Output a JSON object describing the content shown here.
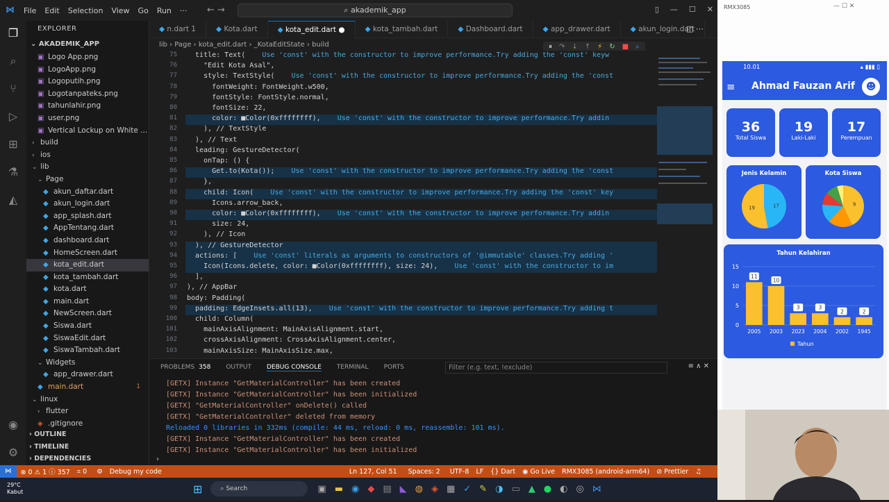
{
  "menu": [
    "File",
    "Edit",
    "Selection",
    "View",
    "Go",
    "Run",
    "···"
  ],
  "search_label": "akademik_app",
  "explorer_title": "EXPLORER",
  "project": "AKADEMIK_APP",
  "tree": [
    {
      "label": "Logo App.png",
      "type": "img",
      "indent": 2
    },
    {
      "label": "LogoApp.png",
      "type": "img",
      "indent": 2
    },
    {
      "label": "Logoputih.png",
      "type": "img",
      "indent": 2
    },
    {
      "label": "Logotanpateks.png",
      "type": "img",
      "indent": 2
    },
    {
      "label": "tahunlahir.png",
      "type": "img",
      "indent": 2
    },
    {
      "label": "user.png",
      "type": "img",
      "indent": 2
    },
    {
      "label": "Vertical Lockup on White ...",
      "type": "img",
      "indent": 2
    },
    {
      "label": "build",
      "type": "folder",
      "indent": 1,
      "open": false
    },
    {
      "label": "ios",
      "type": "folder",
      "indent": 1,
      "open": false
    },
    {
      "label": "lib",
      "type": "folder",
      "indent": 1,
      "open": true
    },
    {
      "label": "Page",
      "type": "folder",
      "indent": 2,
      "open": true
    },
    {
      "label": "akun_daftar.dart",
      "type": "dart",
      "indent": 3
    },
    {
      "label": "akun_login.dart",
      "type": "dart",
      "indent": 3
    },
    {
      "label": "app_splash.dart",
      "type": "dart",
      "indent": 3
    },
    {
      "label": "AppTentang.dart",
      "type": "dart",
      "indent": 3
    },
    {
      "label": "dashboard.dart",
      "type": "dart",
      "indent": 3
    },
    {
      "label": "HomeScreen.dart",
      "type": "dart",
      "indent": 3
    },
    {
      "label": "kota_edit.dart",
      "type": "dart",
      "indent": 3,
      "selected": true
    },
    {
      "label": "kota_tambah.dart",
      "type": "dart",
      "indent": 3
    },
    {
      "label": "kota.dart",
      "type": "dart",
      "indent": 3
    },
    {
      "label": "main.dart",
      "type": "dart",
      "indent": 3
    },
    {
      "label": "NewScreen.dart",
      "type": "dart",
      "indent": 3
    },
    {
      "label": "Siswa.dart",
      "type": "dart",
      "indent": 3
    },
    {
      "label": "SiswaEdit.dart",
      "type": "dart",
      "indent": 3
    },
    {
      "label": "SiswaTambah.dart",
      "type": "dart",
      "indent": 3
    },
    {
      "label": "Widgets",
      "type": "folder",
      "indent": 2,
      "open": true
    },
    {
      "label": "app_drawer.dart",
      "type": "dart",
      "indent": 3
    },
    {
      "label": "main.dart",
      "type": "dart",
      "indent": 2,
      "badge": "1",
      "orange": true
    },
    {
      "label": "linux",
      "type": "folder",
      "indent": 1,
      "open": true
    },
    {
      "label": "flutter",
      "type": "folder",
      "indent": 2,
      "open": false
    },
    {
      "label": ".gitignore",
      "type": "git",
      "indent": 2
    }
  ],
  "outline": [
    "OUTLINE",
    "TIMELINE",
    "DEPENDENCIES"
  ],
  "tabs": [
    {
      "label": "n.dart 1",
      "active": false
    },
    {
      "label": "Kota.dart",
      "active": false
    },
    {
      "label": "kota_edit.dart",
      "active": true
    },
    {
      "label": "kota_tambah.dart",
      "active": false
    },
    {
      "label": "Dashboard.dart",
      "active": false
    },
    {
      "label": "app_drawer.dart",
      "active": false
    },
    {
      "label": "akun_login.dart",
      "active": false
    }
  ],
  "breadcrumb": "lib › Page › kota_edit.dart › _KotaEditState › build",
  "code_lines": [
    {
      "n": "75",
      "t": "  title: Text(    ",
      "h": "Use 'const' with the constructor to improve performance.Try adding the 'const' keyw"
    },
    {
      "n": "76",
      "t": "    \"Edit Kota Asal\",",
      "h": ""
    },
    {
      "n": "77",
      "t": "    style: TextStyle(    ",
      "h": "Use 'const' with the constructor to improve performance.Try adding the 'const"
    },
    {
      "n": "78",
      "t": "      fontWeight: FontWeight.w500,",
      "h": ""
    },
    {
      "n": "79",
      "t": "      fontStyle: FontStyle.normal,",
      "h": ""
    },
    {
      "n": "80",
      "t": "      fontSize: 22,",
      "h": ""
    },
    {
      "n": "81",
      "t": "      color: ■Color(0xffffffff),    ",
      "h": "Use 'const' with the constructor to improve performance.Try addin"
    },
    {
      "n": "82",
      "t": "    ), // TextStyle",
      "h": ""
    },
    {
      "n": "83",
      "t": "  ), // Text",
      "h": ""
    },
    {
      "n": "84",
      "t": "  leading: GestureDetector(",
      "h": ""
    },
    {
      "n": "85",
      "t": "    onTap: () {",
      "h": ""
    },
    {
      "n": "86",
      "t": "      Get.to(Kota());    ",
      "h": "Use 'const' with the constructor to improve performance.Try adding the 'const"
    },
    {
      "n": "87",
      "t": "    },",
      "h": ""
    },
    {
      "n": "88",
      "t": "    child: Icon(    ",
      "h": "Use 'const' with the constructor to improve performance.Try adding the 'const' key"
    },
    {
      "n": "89",
      "t": "      Icons.arrow_back,",
      "h": ""
    },
    {
      "n": "90",
      "t": "      color: ■Color(0xffffffff),    ",
      "h": "Use 'const' with the constructor to improve performance.Try addin"
    },
    {
      "n": "91",
      "t": "      size: 24,",
      "h": ""
    },
    {
      "n": "92",
      "t": "    ), // Icon",
      "h": ""
    },
    {
      "n": "93",
      "t": "  ), // GestureDetector",
      "h": ""
    },
    {
      "n": "94",
      "t": "  actions: [    ",
      "h": "Use 'const' literals as arguments to constructors of '@immutable' classes.Try adding '"
    },
    {
      "n": "95",
      "t": "    Icon(Icons.delete, color: ■Color(0xffffffff), size: 24),    ",
      "h": "Use 'const' with the constructor to im"
    },
    {
      "n": "96",
      "t": "  ],",
      "h": ""
    },
    {
      "n": "97",
      "t": "), // AppBar",
      "h": ""
    },
    {
      "n": "98",
      "t": "body: Padding(",
      "h": ""
    },
    {
      "n": "99",
      "t": "  padding: EdgeInsets.all(13),    ",
      "h": "Use 'const' with the constructor to improve performance.Try adding t"
    },
    {
      "n": "100",
      "t": "  child: Column(",
      "h": ""
    },
    {
      "n": "101",
      "t": "    mainAxisAlignment: MainAxisAlignment.start,",
      "h": ""
    },
    {
      "n": "102",
      "t": "    crossAxisAlignment: CrossAxisAlignment.center,",
      "h": ""
    },
    {
      "n": "103",
      "t": "    mainAxisSize: MainAxisSize.max,",
      "h": ""
    }
  ],
  "panel_tabs": [
    "PROBLEMS",
    "358",
    "OUTPUT",
    "DEBUG CONSOLE",
    "TERMINAL",
    "PORTS"
  ],
  "panel_filter": "Filter (e.g. text, !exclude)",
  "console": [
    {
      "t": "[GETX] Instance \"GetMaterialController\" has been created",
      "blue": false
    },
    {
      "t": "[GETX] Instance \"GetMaterialController\" has been initialized",
      "blue": false
    },
    {
      "t": "[GETX] \"GetMaterialController\" onDelete() called",
      "blue": false
    },
    {
      "t": "[GETX] \"GetMaterialController\" deleted from memory",
      "blue": false
    },
    {
      "t": "Reloaded 0 libraries in 332ms (compile: 44 ms, reload: 0 ms, reassemble: 101 ms).",
      "blue": true
    },
    {
      "t": "[GETX] Instance \"GetMaterialController\" has been created",
      "blue": false
    },
    {
      "t": "[GETX] Instance \"GetMaterialController\" has been initialized",
      "blue": false
    }
  ],
  "status": {
    "errors": "⊗ 0 ⚠ 1 ⓘ 357",
    "ports": "⌗ 0",
    "debug": "Debug my code",
    "position": "Ln 127, Col 51",
    "spaces": "Spaces: 2",
    "encoding": "UTF-8",
    "eol": "LF",
    "lang": "Dart",
    "golive": "Go Live",
    "device": "RMX3085 (android-arm64)",
    "prettier": "Prettier"
  },
  "taskbar": {
    "weather_temp": "29°C",
    "weather_desc": "Kabut",
    "search": "Search"
  },
  "phone": {
    "window_title": "RMX3085",
    "time": "10.01",
    "appbar_title": "Ahmad Fauzan Arif",
    "stats": [
      {
        "num": "36",
        "label": "Total Siswa"
      },
      {
        "num": "19",
        "label": "Laki-Laki"
      },
      {
        "num": "17",
        "label": "Perempuan"
      }
    ],
    "pie1_title": "Jenis Kelamin",
    "pie2_title": "Kota Siswa",
    "bar_title": "Tahun Kelahiran",
    "bar_legend": "Tahun"
  },
  "chart_data": [
    {
      "type": "pie",
      "title": "Jenis Kelamin",
      "values": [
        17,
        19
      ],
      "colors": [
        "#29b6f6",
        "#fbc02d"
      ]
    },
    {
      "type": "pie",
      "title": "Kota Siswa",
      "values": [
        9,
        4,
        3,
        2,
        2,
        1
      ],
      "labels": [
        "9",
        "",
        "",
        "",
        "",
        ""
      ],
      "colors": [
        "#fbc02d",
        "#ff9800",
        "#29b6f6",
        "#e53935",
        "#43a047",
        "#fff176"
      ]
    },
    {
      "type": "bar",
      "title": "Tahun Kelahiran",
      "categories": [
        "2005",
        "2003",
        "2023",
        "2004",
        "2002",
        "1945"
      ],
      "values": [
        11,
        10,
        3,
        3,
        2,
        2
      ],
      "ylim": [
        0,
        15
      ],
      "yticks": [
        "0",
        "5",
        "10",
        "15"
      ],
      "legend": "Tahun",
      "color": "#fbc02d"
    }
  ]
}
